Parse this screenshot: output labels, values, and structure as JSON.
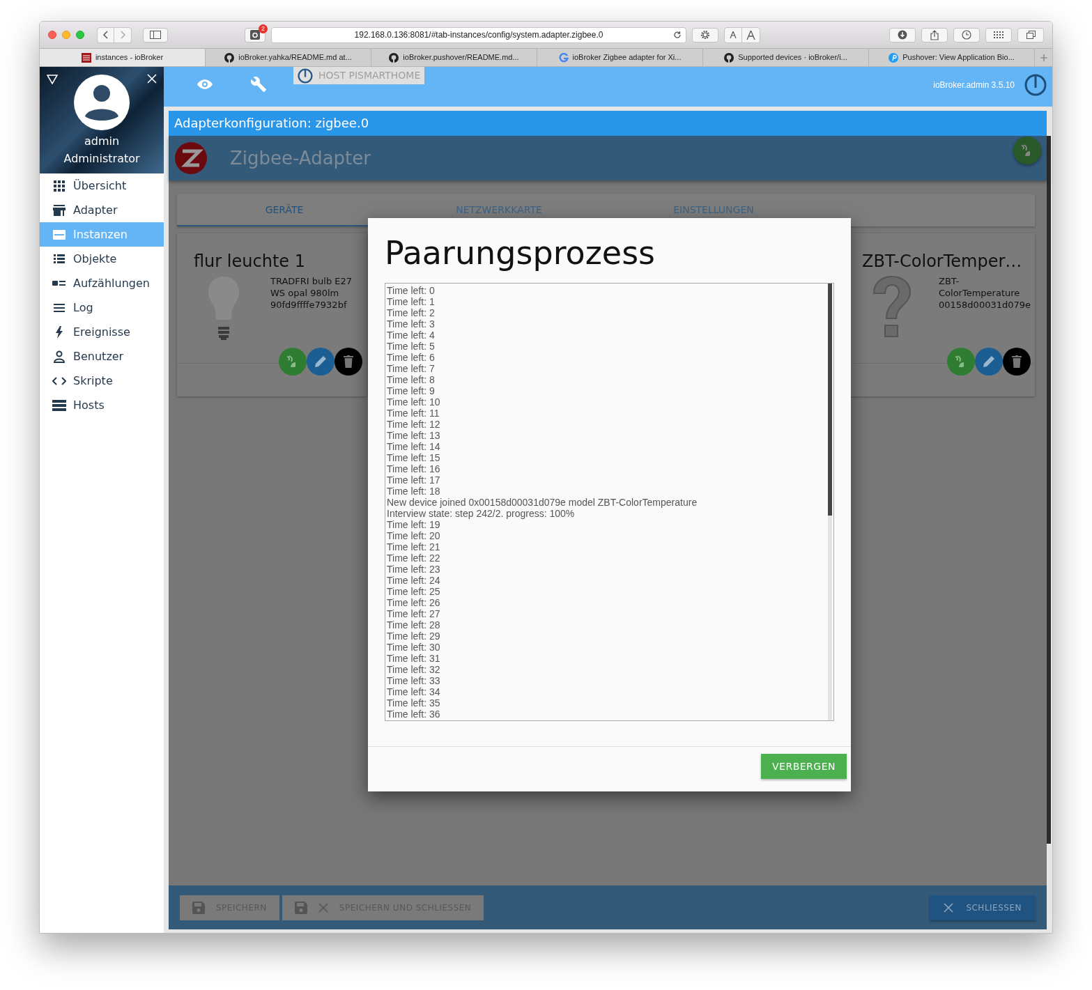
{
  "browser": {
    "url": "192.168.0.136:8081/#tab-instances/config/system.adapter.zigbee.0",
    "badge": "2",
    "tabs": [
      {
        "title": "instances - ioBroker",
        "selected": true
      },
      {
        "title": "ioBroker.yahka/README.md at...",
        "selected": false
      },
      {
        "title": "ioBroker.pushover/README.md...",
        "selected": false
      },
      {
        "title": "ioBroker Zigbee adapter for Xi...",
        "selected": false
      },
      {
        "title": "Supported devices · ioBroker/i...",
        "selected": false
      },
      {
        "title": "Pushover: View Application Bio...",
        "selected": false
      }
    ]
  },
  "sidebar": {
    "user_name": "admin",
    "user_role": "Administrator",
    "items": [
      {
        "label": "Übersicht",
        "selected": false
      },
      {
        "label": "Adapter",
        "selected": false
      },
      {
        "label": "Instanzen",
        "selected": true
      },
      {
        "label": "Objekte",
        "selected": false
      },
      {
        "label": "Aufzählungen",
        "selected": false
      },
      {
        "label": "Log",
        "selected": false
      },
      {
        "label": "Ereignisse",
        "selected": false
      },
      {
        "label": "Benutzer",
        "selected": false
      },
      {
        "label": "Skripte",
        "selected": false
      },
      {
        "label": "Hosts",
        "selected": false
      }
    ]
  },
  "toolbar": {
    "host_button": "HOST PISMARTHOME",
    "version": "ioBroker.admin 3.5.10"
  },
  "config": {
    "title": "Adapterkonfiguration: zigbee.0",
    "adapter_name": "Zigbee-Adapter",
    "tabs": [
      {
        "label": "GERÄTE",
        "selected": true
      },
      {
        "label": "NETZWERKKARTE",
        "selected": false
      },
      {
        "label": "EINSTELLUNGEN",
        "selected": false
      }
    ],
    "devices": [
      {
        "name": "flur leuchte 1",
        "kind": "bulb",
        "model": "TRADFRI bulb E27 WS opal 980lm",
        "id": "90fd9ffffe7932bf"
      },
      {
        "name": "ZBT-ColorTemper…",
        "kind": "unknown",
        "model": "ZBT-ColorTemperature",
        "id": "00158d00031d079e"
      }
    ],
    "footer_buttons": [
      {
        "label": "SPEICHERN"
      },
      {
        "label": "SPEICHERN UND SCHLIESSEN"
      }
    ],
    "close_button": "SCHLIESSEN"
  },
  "dialog": {
    "title": "Paarungsprozess",
    "button": "VERBERGEN",
    "log_lines": [
      "Time left: 0",
      "Time left: 1",
      "Time left: 2",
      "Time left: 3",
      "Time left: 4",
      "Time left: 5",
      "Time left: 6",
      "Time left: 7",
      "Time left: 8",
      "Time left: 9",
      "Time left: 10",
      "Time left: 11",
      "Time left: 12",
      "Time left: 13",
      "Time left: 14",
      "Time left: 15",
      "Time left: 16",
      "Time left: 17",
      "Time left: 18",
      "New device joined 0x00158d00031d079e model ZBT-ColorTemperature",
      "Interview state: step 242/2. progress: 100%",
      "Time left: 19",
      "Time left: 20",
      "Time left: 21",
      "Time left: 22",
      "Time left: 23",
      "Time left: 24",
      "Time left: 25",
      "Time left: 26",
      "Time left: 27",
      "Time left: 28",
      "Time left: 29",
      "Time left: 30",
      "Time left: 31",
      "Time left: 32",
      "Time left: 33",
      "Time left: 34",
      "Time left: 35",
      "Time left: 36"
    ]
  }
}
